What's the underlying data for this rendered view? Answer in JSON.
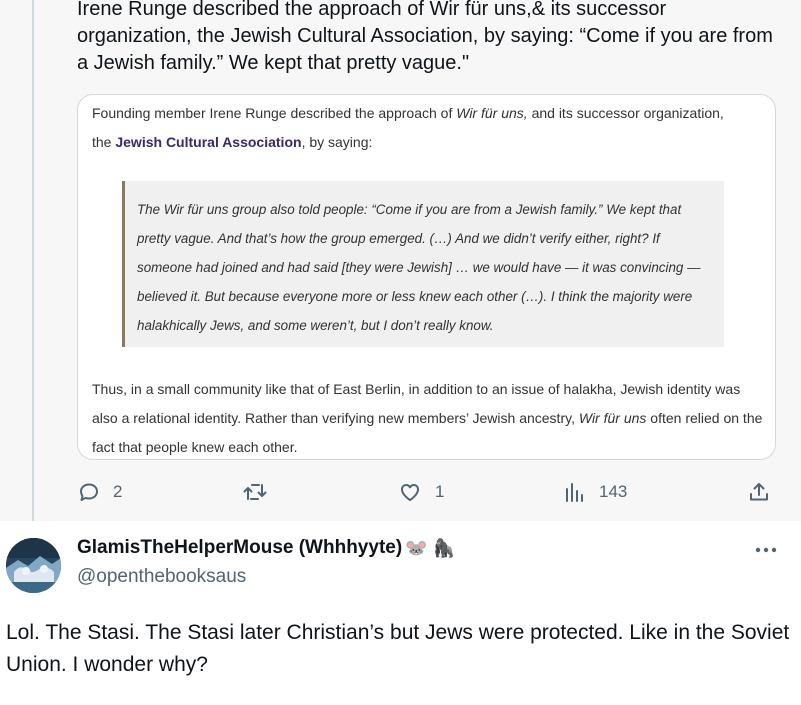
{
  "tweet": {
    "text": "Irene Runge described the approach of Wir für uns,& its successor organization, the Jewish Cultural Association, by saying: “Come if you are from a Jewish family.” We kept that pretty vague.\""
  },
  "quote_card": {
    "intro_before": "Founding member Irene Runge described the approach of ",
    "intro_em": "Wir für uns,",
    "intro_after": " and its successor organization,",
    "intro_line2_before": "the ",
    "intro_link": "Jewish Cultural Association",
    "intro_line2_after": ", by saying:",
    "blockquote": "The Wir für uns group also told people: “Come if you are from a Jewish family.” We kept that pretty vague. And that’s how the group emerged. (…) And we didn’t verify either, right? If someone had joined and had said [they were Jewish] … we would have — it was convincing — believed it. But because everyone more or less knew each other (…). I think the majority were halakhically Jews, and some weren’t, but I don’t really know.",
    "outro_before": "Thus, in a small community like that of East Berlin, in addition to an issue of halakha, Jewish identity was also a relational identity. Rather than verifying new members’ Jewish ancestry, ",
    "outro_em": "Wir für uns",
    "outro_after": " often relied on the fact that people knew each other."
  },
  "actions": {
    "replies": "2",
    "reposts": "",
    "likes": "1",
    "views": "143"
  },
  "reply": {
    "display_name": "GlamisTheHelperMouse (Whhhyyte)",
    "emojis": "🐭 🦍",
    "handle": "@openthebooksaus",
    "text": "Lol. The Stasi. The Stasi later Christian’s but Jews were protected. Like in the Soviet Union. I wonder why?"
  },
  "colors": {
    "link": "#3b2673",
    "icon": "#536471",
    "background_top": "#f7f7f7"
  },
  "icons": [
    "reply-icon",
    "repost-icon",
    "like-icon",
    "views-icon",
    "share-icon",
    "more-icon"
  ]
}
